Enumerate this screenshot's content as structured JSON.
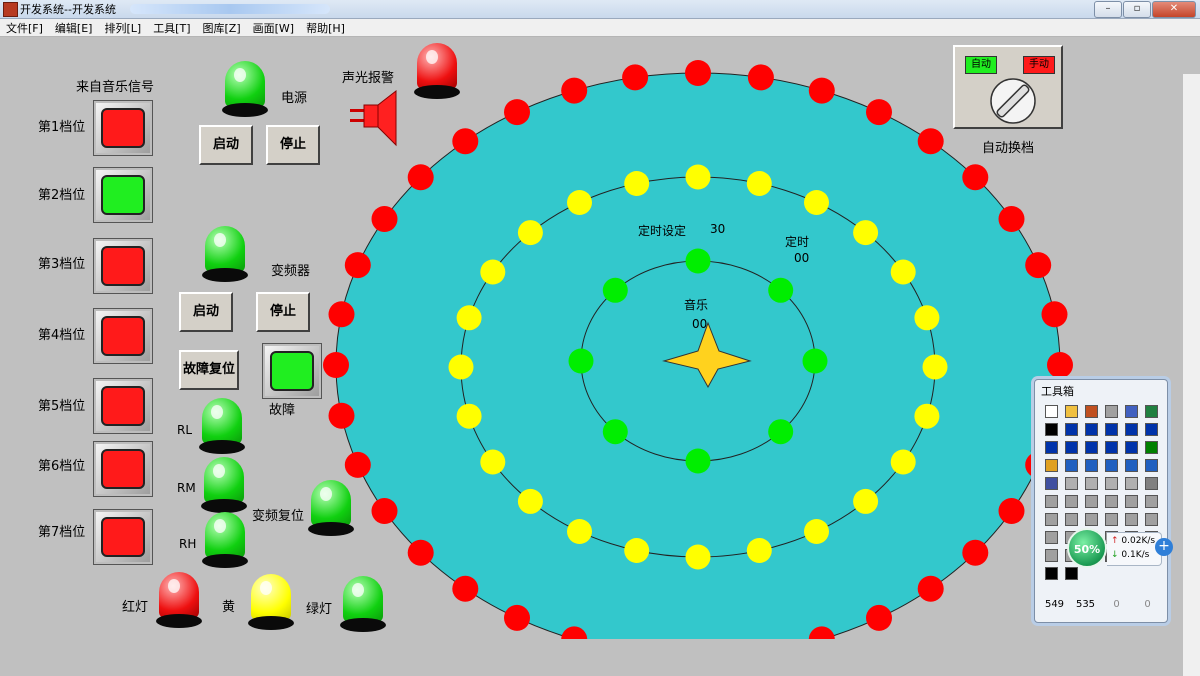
{
  "window": {
    "title": "开发系统--开发系统"
  },
  "menu": [
    "文件[F]",
    "编辑[E]",
    "排列[L]",
    "工具[T]",
    "图库[Z]",
    "画面[W]",
    "帮助[H]"
  ],
  "music_panel": {
    "title": "来自音乐信号",
    "gears": [
      {
        "label": "第1档位",
        "state": "red"
      },
      {
        "label": "第2档位",
        "state": "green"
      },
      {
        "label": "第3档位",
        "state": "red"
      },
      {
        "label": "第4档位",
        "state": "red"
      },
      {
        "label": "第5档位",
        "state": "red"
      },
      {
        "label": "第6档位",
        "state": "red"
      },
      {
        "label": "第7档位",
        "state": "red"
      }
    ]
  },
  "power": {
    "label": "电源",
    "start": "启动",
    "stop": "停止"
  },
  "alarm": {
    "label": "声光报警"
  },
  "vfd": {
    "label": "变频器",
    "start": "启动",
    "stop": "停止",
    "reset": "故障复位",
    "fault": "故障"
  },
  "motor_lamps": {
    "rl": "RL",
    "rm": "RM",
    "rh": "RH",
    "vfd_reset": "变频复位"
  },
  "traffic": {
    "red": "红灯",
    "yellow": "黄",
    "green": "绿灯"
  },
  "switch": {
    "auto": "自动",
    "manual": "手动",
    "caption": "自动换档"
  },
  "center": {
    "timer_set_label": "定时设定",
    "timer_set_value": "30",
    "timer_label": "定时",
    "timer_value": "00",
    "music_label": "音乐",
    "music_value": "00"
  },
  "colors": {
    "disc": "#33c8cc",
    "outer_lights": "#ff0000",
    "middle_lights": "#ffff00",
    "inner_lights": "#00ee00",
    "star": "#ffd21e"
  },
  "toolbox": {
    "title": "工具箱",
    "footer": [
      "549",
      "535",
      "0",
      "0"
    ]
  },
  "net_monitor": {
    "percent": "50%",
    "up": "0.02K/s",
    "down": "0.1K/s"
  }
}
